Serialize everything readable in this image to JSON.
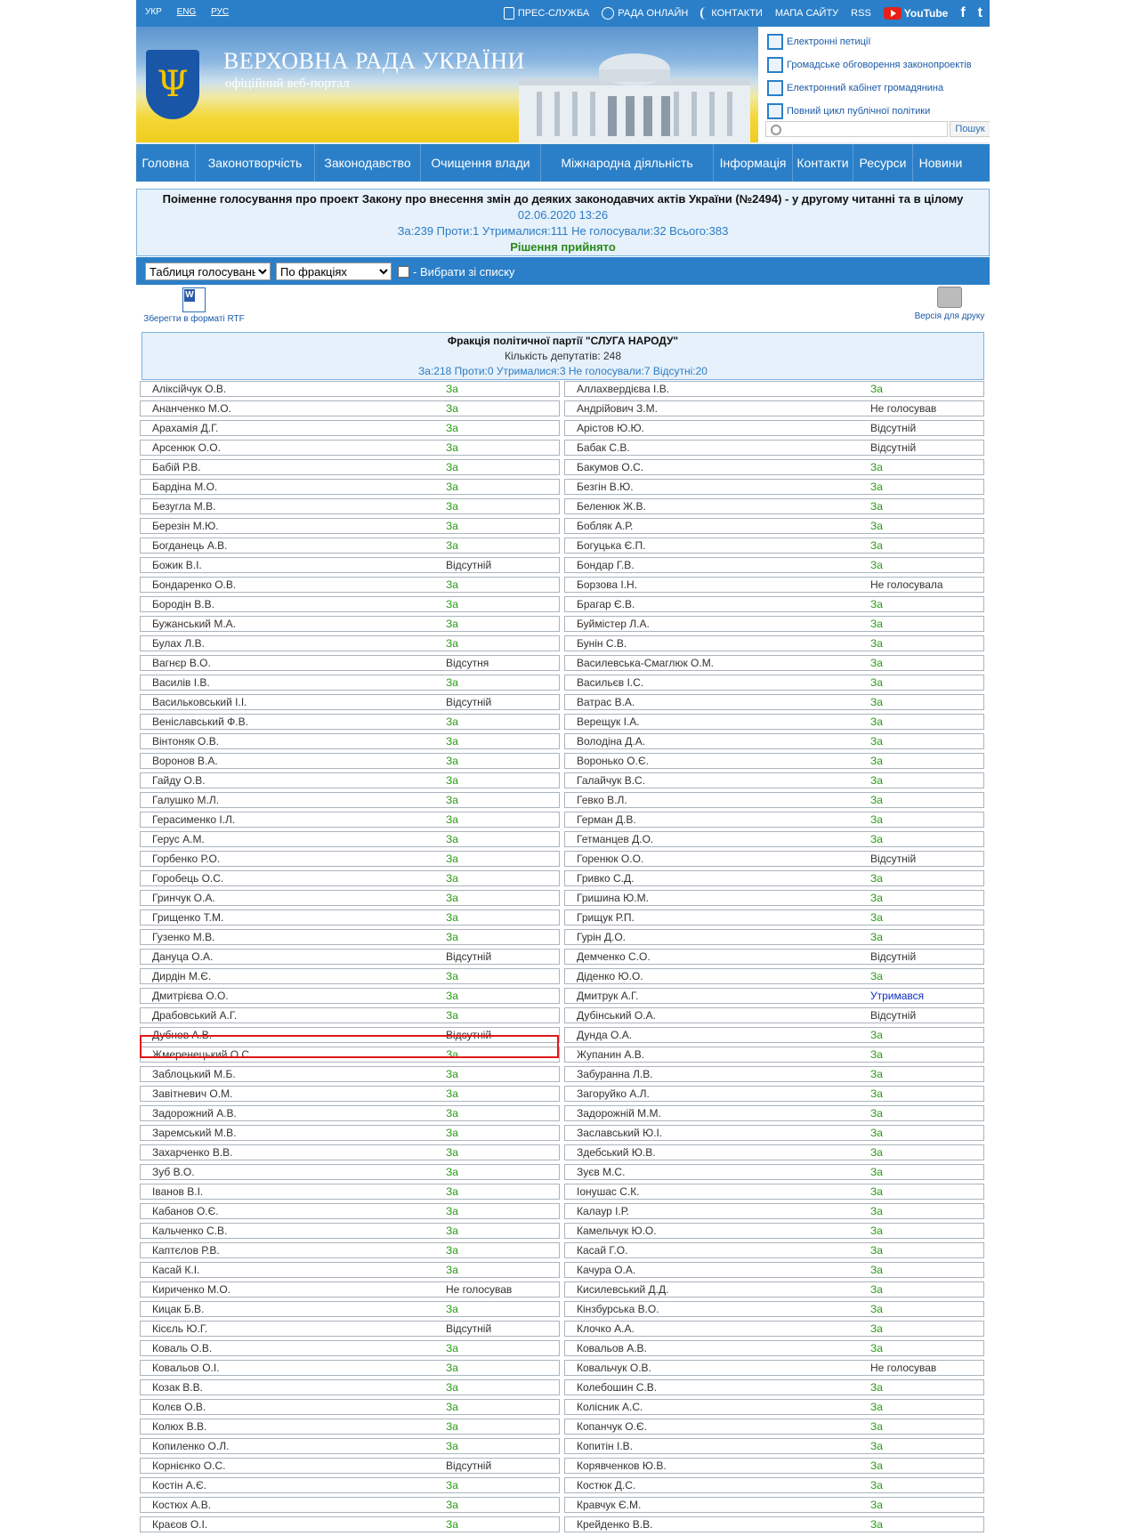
{
  "langs": [
    "УКР",
    "ENG",
    "РУС"
  ],
  "toplinks": {
    "press": "ПРЕС-СЛУЖБА",
    "online": "РАДА ОНЛАЙН",
    "contacts": "КОНТАКТИ",
    "sitemap": "МАПА САЙТУ",
    "rss": "RSS",
    "youtube": "YouTube",
    "facebook": "f",
    "twitter": "t"
  },
  "header": {
    "title": "ВЕРХОВНА РАДА УКРАЇНИ",
    "subtitle": "офіційний веб-портал"
  },
  "elinks": [
    "Електронні петиції",
    "Громадське обговорення законопроектів",
    "Електронний кабінет громадянина",
    "Повний цикл публічної політики"
  ],
  "search": {
    "button": "Пошук",
    "placeholder": ""
  },
  "nav": [
    "Головна",
    "Законотворчість",
    "Законодавство",
    "Очищення влади",
    "Міжнародна діяльність",
    "Інформація",
    "Контакти",
    "Ресурси",
    "Новини"
  ],
  "vote": {
    "title": "Поіменне голосування про проект Закону про внесення змін до деяких законодавчих актів України (№2494) - у другому читанні та в цілому",
    "datetime": "02.06.2020 13:26",
    "summary": "За:239 Проти:1 Утрималися:111 Не голосували:32 Всього:383",
    "decision": "Рішення прийнято"
  },
  "filters": {
    "view": "Таблиця голосувань",
    "group": "По фракціях",
    "choose": "- Вибрати зі списку"
  },
  "tools": {
    "rtf": "Зберегти в форматі RTF",
    "print": "Версія для друку"
  },
  "faction": {
    "name": "Фракція політичної партії \"СЛУГА НАРОДУ\"",
    "count": "Кількість депутатів: 248",
    "summary": "За:218 Проти:0 Утрималися:3 Не голосували:7 Відсутні:20"
  },
  "left": [
    [
      "Аліксійчук О.В.",
      "За"
    ],
    [
      "Ананченко М.О.",
      "За"
    ],
    [
      "Арахамія Д.Г.",
      "За"
    ],
    [
      "Арсенюк О.О.",
      "За"
    ],
    [
      "Бабій Р.В.",
      "За"
    ],
    [
      "Бардіна М.О.",
      "За"
    ],
    [
      "Безугла М.В.",
      "За"
    ],
    [
      "Березін М.Ю.",
      "За"
    ],
    [
      "Богданець А.В.",
      "За"
    ],
    [
      "Божик В.І.",
      "Відсутній"
    ],
    [
      "Бондаренко О.В.",
      "За"
    ],
    [
      "Бородін В.В.",
      "За"
    ],
    [
      "Бужанський М.А.",
      "За"
    ],
    [
      "Булах Л.В.",
      "За"
    ],
    [
      "Вагнєр В.О.",
      "Відсутня"
    ],
    [
      "Василів І.В.",
      "За"
    ],
    [
      "Васильковський І.І.",
      "Відсутній"
    ],
    [
      "Веніславський Ф.В.",
      "За"
    ],
    [
      "Вінтоняк О.В.",
      "За"
    ],
    [
      "Воронов В.А.",
      "За"
    ],
    [
      "Гайду О.В.",
      "За"
    ],
    [
      "Галушко М.Л.",
      "За"
    ],
    [
      "Герасименко І.Л.",
      "За"
    ],
    [
      "Герус А.М.",
      "За"
    ],
    [
      "Горбенко Р.О.",
      "За"
    ],
    [
      "Горобець О.С.",
      "За"
    ],
    [
      "Гринчук О.А.",
      "За"
    ],
    [
      "Грищенко Т.М.",
      "За"
    ],
    [
      "Гузенко М.В.",
      "За"
    ],
    [
      "Дануца О.А.",
      "Відсутній"
    ],
    [
      "Дирдін М.Є.",
      "За"
    ],
    [
      "Дмитрієва О.О.",
      "За"
    ],
    [
      "Драбовський А.Г.",
      "За"
    ],
    [
      "Дубнов А.В.",
      "Відсутній"
    ],
    [
      "Жмеренецький О.С.",
      "За"
    ],
    [
      "Заблоцький М.Б.",
      "За"
    ],
    [
      "Завітневич О.М.",
      "За"
    ],
    [
      "Задорожний А.В.",
      "За"
    ],
    [
      "Заремський М.В.",
      "За"
    ],
    [
      "Захарченко В.В.",
      "За"
    ],
    [
      "Зуб В.О.",
      "За"
    ],
    [
      "Іванов В.І.",
      "За"
    ],
    [
      "Кабанов О.Є.",
      "За"
    ],
    [
      "Кальченко С.В.",
      "За"
    ],
    [
      "Каптєлов Р.В.",
      "За"
    ],
    [
      "Касай К.І.",
      "За"
    ],
    [
      "Кириченко М.О.",
      "Не голосував"
    ],
    [
      "Кицак Б.В.",
      "За"
    ],
    [
      "Кісєль Ю.Г.",
      "Відсутній"
    ],
    [
      "Коваль О.В.",
      "За"
    ],
    [
      "Ковальов О.І.",
      "За"
    ],
    [
      "Козак В.В.",
      "За"
    ],
    [
      "Колєв О.В.",
      "За"
    ],
    [
      "Колюх В.В.",
      "За"
    ],
    [
      "Копиленко О.Л.",
      "За"
    ],
    [
      "Корнієнко О.С.",
      "Відсутній"
    ],
    [
      "Костін А.Є.",
      "За"
    ],
    [
      "Костюх А.В.",
      "За"
    ],
    [
      "Краєов О.І.",
      "За"
    ]
  ],
  "right": [
    [
      "Аллахвердієва І.В.",
      "За"
    ],
    [
      "Андрійович З.М.",
      "Не голосував"
    ],
    [
      "Арістов Ю.Ю.",
      "Відсутній"
    ],
    [
      "Бабак С.В.",
      "Відсутній"
    ],
    [
      "Бакумов О.С.",
      "За"
    ],
    [
      "Безгін В.Ю.",
      "За"
    ],
    [
      "Беленюк Ж.В.",
      "За"
    ],
    [
      "Бобляк А.Р.",
      "За"
    ],
    [
      "Богуцька Є.П.",
      "За"
    ],
    [
      "Бондар Г.В.",
      "За"
    ],
    [
      "Борзова І.Н.",
      "Не голосувала"
    ],
    [
      "Брагар Є.В.",
      "За"
    ],
    [
      "Буймістер Л.А.",
      "За"
    ],
    [
      "Бунін С.В.",
      "За"
    ],
    [
      "Василевська-Смаглюк О.М.",
      "За"
    ],
    [
      "Васильєв І.С.",
      "За"
    ],
    [
      "Ватрас В.А.",
      "За"
    ],
    [
      "Верещук І.А.",
      "За"
    ],
    [
      "Володіна Д.А.",
      "За"
    ],
    [
      "Воронько О.Є.",
      "За"
    ],
    [
      "Галайчук В.С.",
      "За"
    ],
    [
      "Гевко В.Л.",
      "За"
    ],
    [
      "Герман Д.В.",
      "За"
    ],
    [
      "Гетманцев Д.О.",
      "За"
    ],
    [
      "Горенюк О.О.",
      "Відсутній"
    ],
    [
      "Гривко С.Д.",
      "За"
    ],
    [
      "Гришина Ю.М.",
      "За"
    ],
    [
      "Грищук Р.П.",
      "За"
    ],
    [
      "Гурін Д.О.",
      "За"
    ],
    [
      "Демченко С.О.",
      "Відсутній"
    ],
    [
      "Діденко Ю.О.",
      "За"
    ],
    [
      "Дмитрук А.Г.",
      "Утримався"
    ],
    [
      "Дубінський О.А.",
      "Відсутній"
    ],
    [
      "Дунда О.А.",
      "За"
    ],
    [
      "Жупанин А.В.",
      "За"
    ],
    [
      "Забуранна Л.В.",
      "За"
    ],
    [
      "Загоруйко А.Л.",
      "За"
    ],
    [
      "Задорожній М.М.",
      "За"
    ],
    [
      "Заславський Ю.І.",
      "За"
    ],
    [
      "Здебський Ю.В.",
      "За"
    ],
    [
      "Зуєв М.С.",
      "За"
    ],
    [
      "Іонушас С.К.",
      "За"
    ],
    [
      "Калаур І.Р.",
      "За"
    ],
    [
      "Камельчук Ю.О.",
      "За"
    ],
    [
      "Касай Г.О.",
      "За"
    ],
    [
      "Качура О.А.",
      "За"
    ],
    [
      "Кисилевський Д.Д.",
      "За"
    ],
    [
      "Кінзбурська В.О.",
      "За"
    ],
    [
      "Клочко А.А.",
      "За"
    ],
    [
      "Ковальов А.В.",
      "За"
    ],
    [
      "Ковальчук О.В.",
      "Не голосував"
    ],
    [
      "Колебошин С.В.",
      "За"
    ],
    [
      "Колісник А.С.",
      "За"
    ],
    [
      "Копанчук О.Є.",
      "За"
    ],
    [
      "Копитін І.В.",
      "За"
    ],
    [
      "Корявченков Ю.В.",
      "За"
    ],
    [
      "Костюк Д.С.",
      "За"
    ],
    [
      "Кравчук Є.М.",
      "За"
    ],
    [
      "Крейденко В.В.",
      "За"
    ]
  ]
}
